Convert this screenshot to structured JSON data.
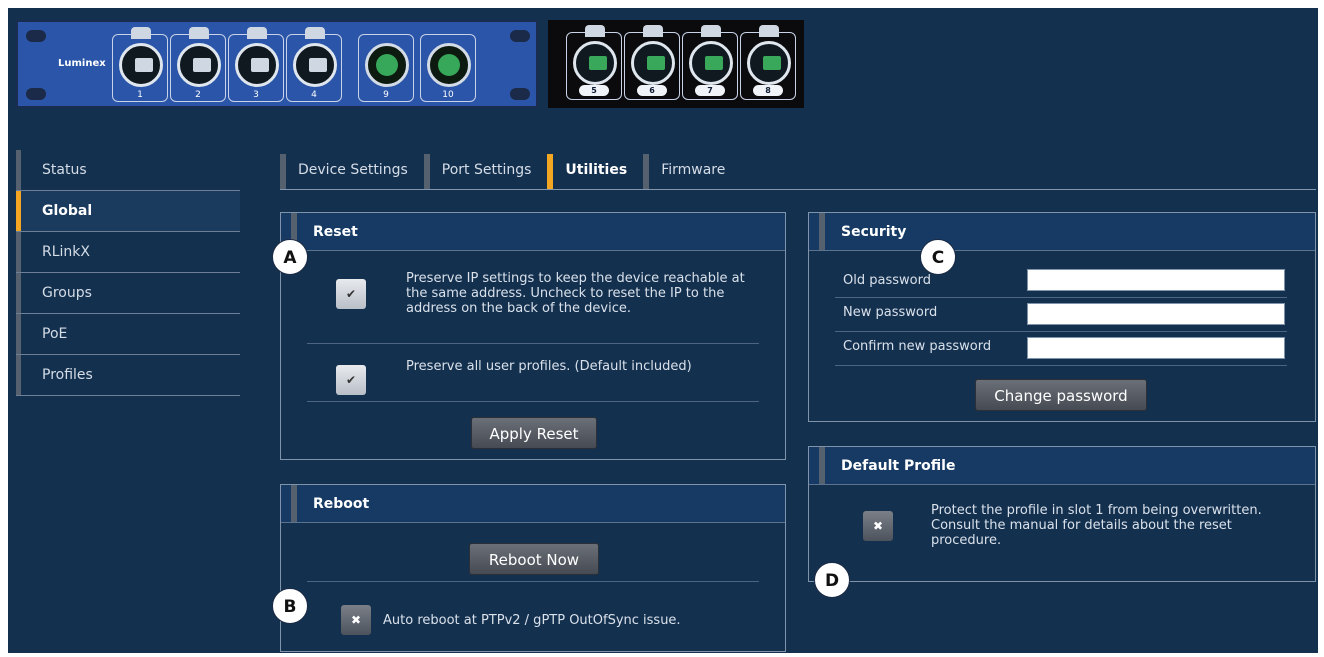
{
  "device": {
    "brand": "Luminex",
    "copper_ports": [
      "1",
      "2",
      "3",
      "4"
    ],
    "combo_ports": [
      "9",
      "10"
    ],
    "sfp_ports": [
      "5",
      "6",
      "7",
      "8"
    ]
  },
  "sidebar": {
    "items": [
      {
        "label": "Status"
      },
      {
        "label": "Global"
      },
      {
        "label": "RLinkX"
      },
      {
        "label": "Groups"
      },
      {
        "label": "PoE"
      },
      {
        "label": "Profiles"
      }
    ],
    "active": "Global"
  },
  "tabs": {
    "items": [
      {
        "label": "Device Settings"
      },
      {
        "label": "Port Settings"
      },
      {
        "label": "Utilities"
      },
      {
        "label": "Firmware"
      }
    ],
    "active": "Utilities"
  },
  "reset": {
    "title": "Reset",
    "preserve_ip_checked": true,
    "preserve_ip_text": "Preserve IP settings to keep the device reachable at the same address. Uncheck to reset the IP to the address on the back of the device.",
    "preserve_profiles_checked": true,
    "preserve_profiles_text": "Preserve all user profiles. (Default included)",
    "apply_button": "Apply Reset"
  },
  "reboot": {
    "title": "Reboot",
    "button": "Reboot Now",
    "auto_reboot_checked": false,
    "auto_reboot_text": "Auto reboot at PTPv2 / gPTP OutOfSync issue."
  },
  "security": {
    "title": "Security",
    "old_password_label": "Old password",
    "new_password_label": "New password",
    "confirm_password_label": "Confirm new password",
    "old_password_value": "",
    "new_password_value": "",
    "confirm_password_value": "",
    "button": "Change password"
  },
  "default_profile": {
    "title": "Default Profile",
    "protect_checked": false,
    "protect_text": "Protect the profile in slot 1 from being overwritten. Consult the manual for details about the reset procedure."
  },
  "annotations": [
    "A",
    "B",
    "C",
    "D"
  ],
  "icons": {
    "checked": "check-mark-icon",
    "unchecked": "x-mark-icon"
  }
}
